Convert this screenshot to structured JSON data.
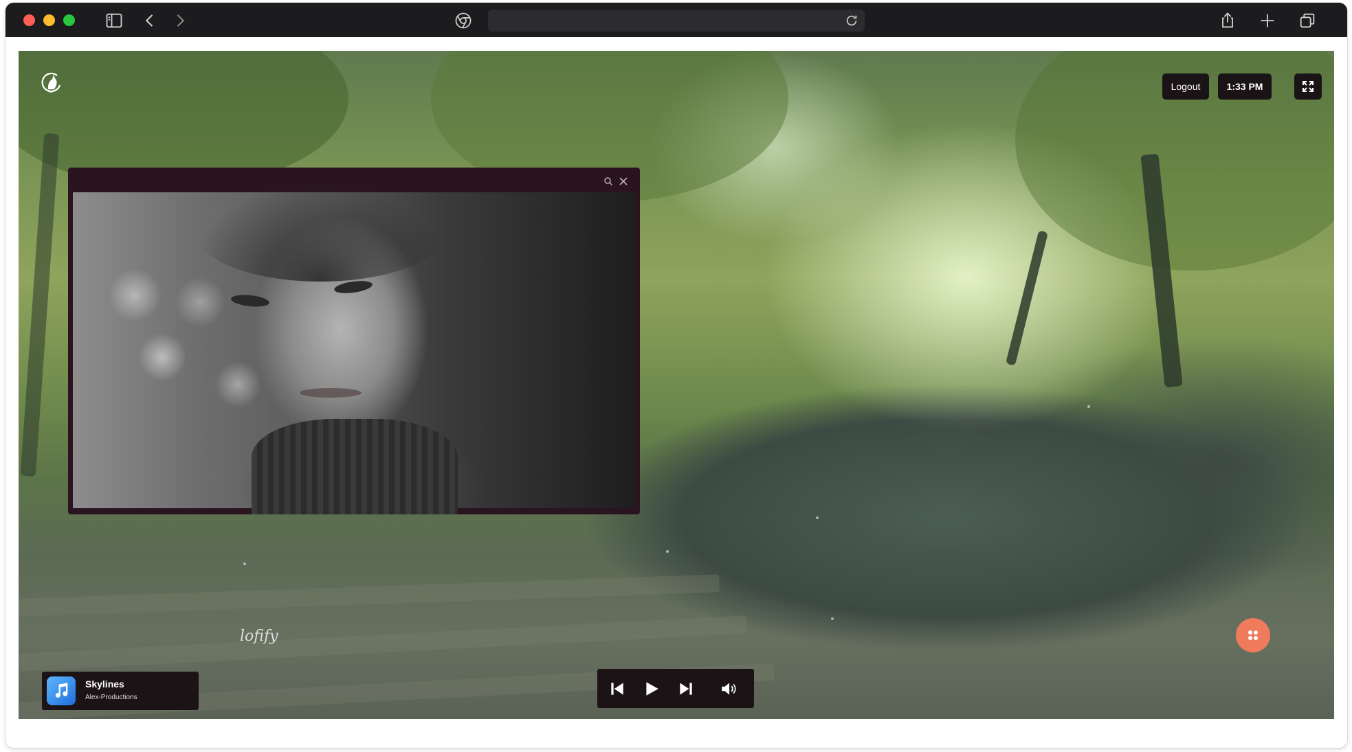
{
  "browser": {
    "address_bar_text": "",
    "icons": [
      "sidebar-icon",
      "back-icon",
      "forward-icon",
      "site-icon",
      "reload-icon",
      "share-icon",
      "new-tab-icon",
      "tabs-icon"
    ]
  },
  "app": {
    "name": "lofify",
    "header": {
      "logout_label": "Logout",
      "time": "1:33 PM"
    },
    "now_playing": {
      "title": "Skylines",
      "artist": "Alex-Productions"
    },
    "video_panel": {
      "icons": [
        "search-icon",
        "close-icon"
      ]
    },
    "player_controls": [
      "previous-icon",
      "play-icon",
      "next-icon",
      "volume-icon"
    ],
    "accent_color": "#ef7a5c"
  }
}
